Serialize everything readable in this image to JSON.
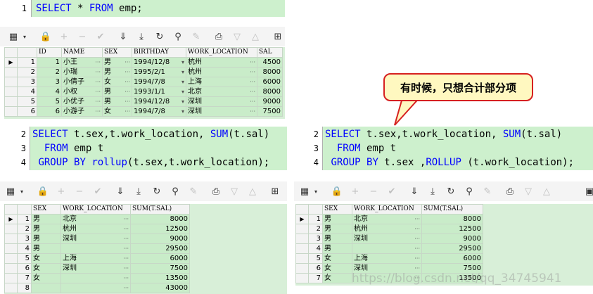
{
  "editor1": {
    "lines": [
      {
        "num": "1",
        "code": "SELECT * FROM emp;"
      }
    ]
  },
  "grid1": {
    "headers": [
      "ID",
      "NAME",
      "SEX",
      "BIRTHDAY",
      "WORK_LOCATION",
      "SAL"
    ],
    "rows": [
      {
        "rn": "1",
        "id": "1",
        "name": "小王",
        "sex": "男",
        "birthday": "1994/12/8",
        "loc": "杭州",
        "sal": "4500"
      },
      {
        "rn": "2",
        "id": "2",
        "name": "小瑞",
        "sex": "男",
        "birthday": "1995/2/1",
        "loc": "杭州",
        "sal": "8000"
      },
      {
        "rn": "3",
        "id": "3",
        "name": "小倩子",
        "sex": "女",
        "birthday": "1994/7/8",
        "loc": "上海",
        "sal": "6000"
      },
      {
        "rn": "4",
        "id": "4",
        "name": "小权",
        "sex": "男",
        "birthday": "1993/1/1",
        "loc": "北京",
        "sal": "8000"
      },
      {
        "rn": "5",
        "id": "5",
        "name": "小优子",
        "sex": "男",
        "birthday": "1994/12/8",
        "loc": "深圳",
        "sal": "9000"
      },
      {
        "rn": "6",
        "id": "6",
        "name": "小游子",
        "sex": "女",
        "birthday": "1994/7/8",
        "loc": "深圳",
        "sal": "7500"
      }
    ]
  },
  "callout": {
    "text": "有时候，只想合计部分项"
  },
  "editor2": {
    "lines": [
      {
        "num": "2",
        "code": "SELECT t.sex,t.work_location, SUM(t.sal)"
      },
      {
        "num": "3",
        "code": "  FROM emp t"
      },
      {
        "num": "4",
        "code": " GROUP BY rollup(t.sex,t.work_location);"
      }
    ]
  },
  "editor3": {
    "lines": [
      {
        "num": "2",
        "code": "SELECT t.sex,t.work_location, SUM(t.sal)"
      },
      {
        "num": "3",
        "code": "  FROM emp t"
      },
      {
        "num": "4",
        "code": " GROUP BY t.sex ,ROLLUP (t.work_location);"
      }
    ]
  },
  "grid2": {
    "headers": [
      "SEX",
      "WORK_LOCATION",
      "SUM(T.SAL)"
    ],
    "rows": [
      {
        "rn": "1",
        "sex": "男",
        "loc": "北京",
        "sum": "8000"
      },
      {
        "rn": "2",
        "sex": "男",
        "loc": "杭州",
        "sum": "12500"
      },
      {
        "rn": "3",
        "sex": "男",
        "loc": "深圳",
        "sum": "9000"
      },
      {
        "rn": "4",
        "sex": "男",
        "loc": "",
        "sum": "29500"
      },
      {
        "rn": "5",
        "sex": "女",
        "loc": "上海",
        "sum": "6000"
      },
      {
        "rn": "6",
        "sex": "女",
        "loc": "深圳",
        "sum": "7500"
      },
      {
        "rn": "7",
        "sex": "女",
        "loc": "",
        "sum": "13500"
      },
      {
        "rn": "8",
        "sex": "",
        "loc": "",
        "sum": "43000"
      }
    ]
  },
  "grid3": {
    "headers": [
      "SEX",
      "WORK_LOCATION",
      "SUM(T.SAL)"
    ],
    "rows": [
      {
        "rn": "1",
        "sex": "男",
        "loc": "北京",
        "sum": "8000"
      },
      {
        "rn": "2",
        "sex": "男",
        "loc": "杭州",
        "sum": "12500"
      },
      {
        "rn": "3",
        "sex": "男",
        "loc": "深圳",
        "sum": "9000"
      },
      {
        "rn": "4",
        "sex": "男",
        "loc": "",
        "sum": "29500"
      },
      {
        "rn": "5",
        "sex": "女",
        "loc": "上海",
        "sum": "6000"
      },
      {
        "rn": "6",
        "sex": "女",
        "loc": "深圳",
        "sum": "7500"
      },
      {
        "rn": "7",
        "sex": "女",
        "loc": "",
        "sum": "13500"
      }
    ]
  },
  "watermark": {
    "text": "https://blog.csdn.net/qq_34745941"
  },
  "colors": {
    "editor_bg": "#cdf0cd",
    "keyword": "#0000ff",
    "grid_cell": "#c9ecc9",
    "callout_border": "#d62020",
    "callout_bg": "#fff8c0"
  }
}
